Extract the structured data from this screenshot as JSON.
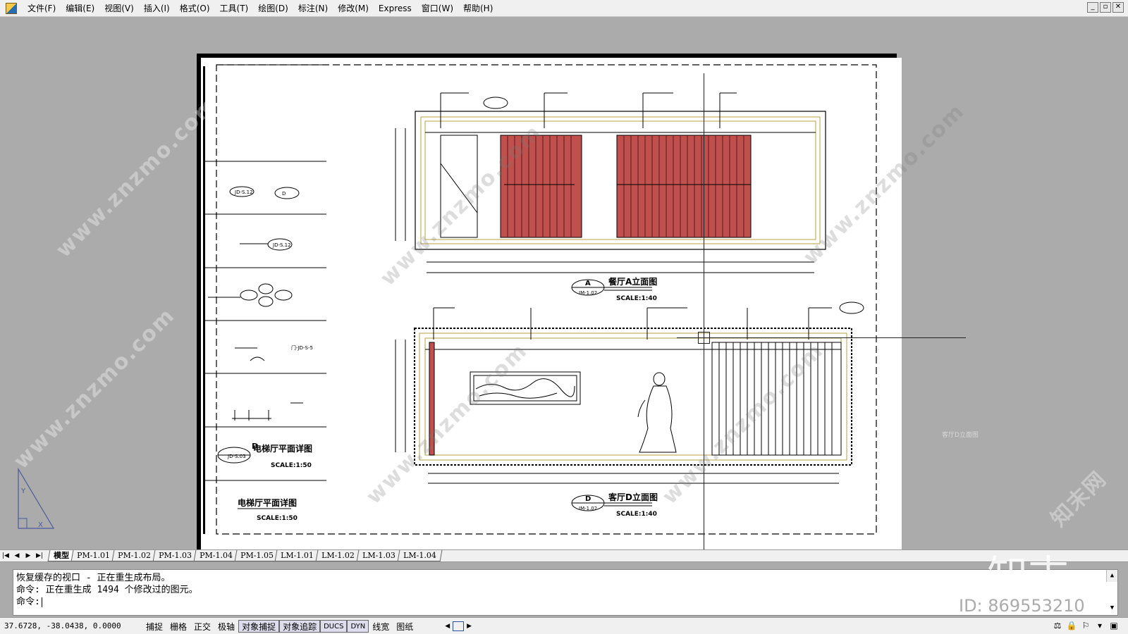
{
  "menubar": {
    "items": [
      "文件(F)",
      "编辑(E)",
      "视图(V)",
      "插入(I)",
      "格式(O)",
      "工具(T)",
      "绘图(D)",
      "标注(N)",
      "修改(M)",
      "Express",
      "窗口(W)",
      "帮助(H)"
    ],
    "window_buttons": [
      "_",
      "▫",
      "✕"
    ]
  },
  "drawing": {
    "elevation_a": {
      "title": "餐厅A立面图",
      "scale": "SCALE:1:40",
      "tag_letter": "A",
      "tag_sheet": "IM-1.02"
    },
    "elevation_d": {
      "title": "客厅D立面图",
      "scale": "SCALE:1:40",
      "tag_letter": "D",
      "tag_sheet": "IM-1.02"
    },
    "legend": {
      "elevator_plan_1": "电梯厅平面详图",
      "elevator_plan_1_scale": "SCALE:1:50",
      "elevator_plan_2": "电梯厅平面详图",
      "elevator_plan_2_scale": "SCALE:1:50",
      "tag_d": "D"
    },
    "faint_label": "客厅D立面图",
    "colors": {
      "slat": "#c0504d",
      "frame_yellow": "#b8a040",
      "line": "#000000"
    }
  },
  "watermarks": {
    "site": "www.znzmo.com",
    "brand": "知末网",
    "logo": "知末",
    "id": "ID: 869553210"
  },
  "tabs": {
    "nav": [
      "|◀",
      "◀",
      "▶",
      "▶|"
    ],
    "items": [
      "模型",
      "PM-1.01",
      "PM-1.02",
      "PM-1.03",
      "PM-1.04",
      "PM-1.05",
      "LM-1.01",
      "LM-1.02",
      "LM-1.03",
      "LM-1.04"
    ],
    "active_index": 0
  },
  "command": {
    "line1": "恢复缓存的视口 - 正在重生成布局。",
    "line2": "命令: 正在重生成 1494 个修改过的图元。",
    "prompt": "命令:"
  },
  "statusbar": {
    "coords": "37.6728,  -38.0438, 0.0000",
    "toggles": [
      {
        "label": "捕捉",
        "on": false
      },
      {
        "label": "栅格",
        "on": false
      },
      {
        "label": "正交",
        "on": false
      },
      {
        "label": "极轴",
        "on": false
      },
      {
        "label": "对象捕捉",
        "on": true
      },
      {
        "label": "对象追踪",
        "on": true
      },
      {
        "label": "DUCS",
        "on": true
      },
      {
        "label": "DYN",
        "on": true
      },
      {
        "label": "线宽",
        "on": false
      },
      {
        "label": "图纸",
        "on": false
      }
    ]
  }
}
